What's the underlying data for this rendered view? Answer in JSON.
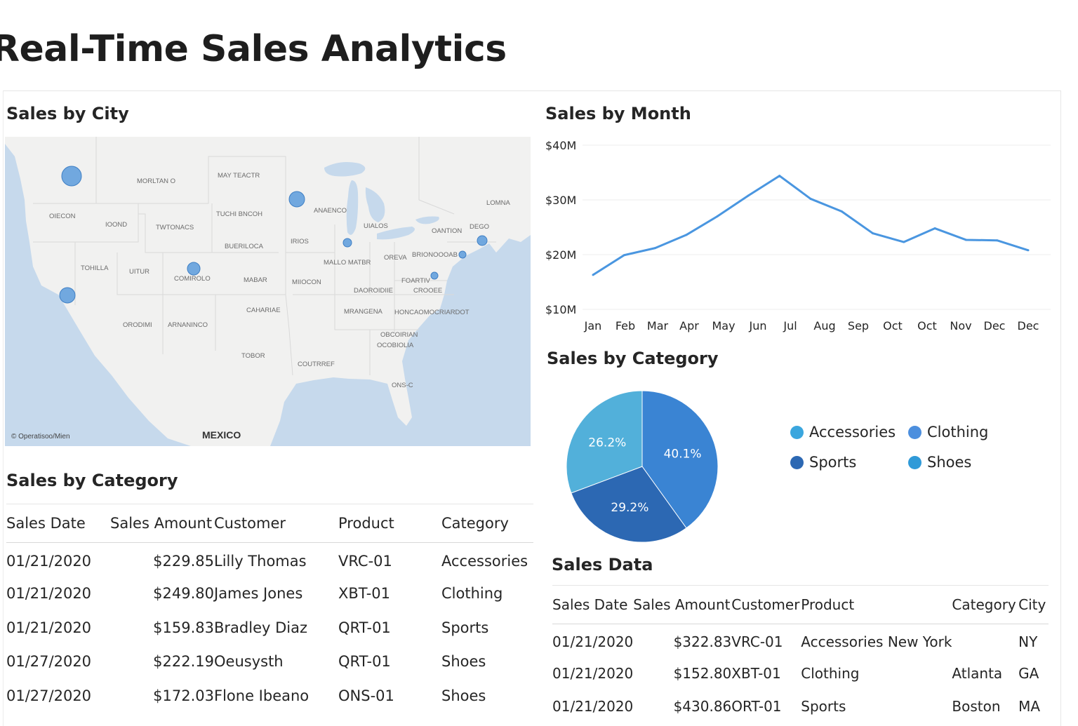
{
  "page": {
    "title": "Real-Time Sales Analytics"
  },
  "map": {
    "title": "Sales by City",
    "copyright": "© Operatisoo/Mien",
    "country_label": "MEXICO",
    "region_labels": [
      "MORLTAN O",
      "MAY TEACTR",
      "OIECON",
      "IOOND",
      "TWTONACS",
      "TUCHI BNCOH",
      "BUERILOCA",
      "TOHILLA",
      "UITUR",
      "COMIROLO",
      "MABAR",
      "CAHARIAE",
      "ORODIMI",
      "ARNANINCO",
      "TOBOR",
      "MIIOCON",
      "MALLO MATBR",
      "OREVA",
      "ANAENCO",
      "DAOROIDIIE",
      "MRANGENA",
      "HONCAOMOCRIARDOT",
      "OBCOIRIAN",
      "OCOBIOLIA",
      "COUTRREF",
      "ONS-C",
      "UIALOS",
      "IRIOS",
      "OANTION",
      "BRIONOOOAB",
      "FOARTIV",
      "CROOEE",
      "LOMNA",
      "DEGO"
    ],
    "colors": {
      "water": "#c6d9ec",
      "land": "#f1f1f0",
      "border": "#d9d9d9",
      "bubble": "#5b9bdc"
    }
  },
  "line_chart_title": "Sales by Month",
  "pie_chart_title": "Sales by Category",
  "chart_data": [
    {
      "type": "line",
      "title": "Sales by Month",
      "categories": [
        "Jan",
        "Feb",
        "Mar",
        "Apr",
        "May",
        "Jun",
        "Jul",
        "Aug",
        "Sep",
        "Oct",
        "Oct",
        "Nov",
        "Dec",
        "Dec"
      ],
      "values": [
        16.3,
        19.9,
        21.2,
        23.6,
        27.0,
        30.8,
        34.4,
        30.2,
        27.9,
        23.9,
        22.3,
        24.8,
        22.7,
        22.6,
        20.8
      ],
      "yticks": [
        "$40M",
        "$30M",
        "$20M",
        "$10M"
      ],
      "ylim": [
        10,
        40
      ],
      "color": "#4a96e0",
      "grid": true
    },
    {
      "type": "pie",
      "title": "Sales by Category",
      "slices": [
        {
          "label": "40.1%",
          "value": 40.1,
          "color": "#3a84d3"
        },
        {
          "label": "29.2%",
          "value": 29.2,
          "color": "#2c68b3"
        },
        {
          "label": "26.2%",
          "value": 30.7,
          "color": "#52b0da"
        }
      ],
      "legend": [
        {
          "name": "Accessories",
          "color": "#3aa6de"
        },
        {
          "name": "Clothing",
          "color": "#4c8fde"
        },
        {
          "name": "Sports",
          "color": "#2c68b3"
        },
        {
          "name": "Shoes",
          "color": "#2f9ad8"
        }
      ],
      "legend_position": "right"
    }
  ],
  "category_table": {
    "title": "Sales by Category",
    "headers": [
      "Sales Date",
      "Sales Amount",
      "Customer",
      "Product",
      "Category"
    ],
    "rows": [
      [
        "01/21/2020",
        "$229.85",
        "Lilly Thomas",
        "VRC-01",
        "Accessories"
      ],
      [
        "01/21/2020",
        "$249.80",
        "James Jones",
        "XBT-01",
        "Clothing"
      ],
      [
        "01/21/2020",
        "$159.83",
        "Bradley Diaz",
        "QRT-01",
        "Sports"
      ],
      [
        "01/27/2020",
        "$222.19",
        "Oeusysth",
        "QRT-01",
        "Shoes"
      ],
      [
        "01/27/2020",
        "$172.03",
        "Flone Ibeano",
        "ONS-01",
        "Shoes"
      ]
    ]
  },
  "sales_table": {
    "title": "Sales Data",
    "headers": [
      "Sales Date",
      "Sales Amount",
      "Customer",
      "Product",
      "Category",
      "City"
    ],
    "rows": [
      [
        "01/21/2020",
        "$322.83",
        "VRC-01",
        "Accessories New York",
        "",
        "NY"
      ],
      [
        "01/21/2020",
        "$152.80",
        "XBT-01",
        "Clothing",
        "Atlanta",
        "GA"
      ],
      [
        "01/21/2020",
        "$430.86",
        "ORT-01",
        "Sports",
        "Boston",
        "MA"
      ]
    ]
  }
}
